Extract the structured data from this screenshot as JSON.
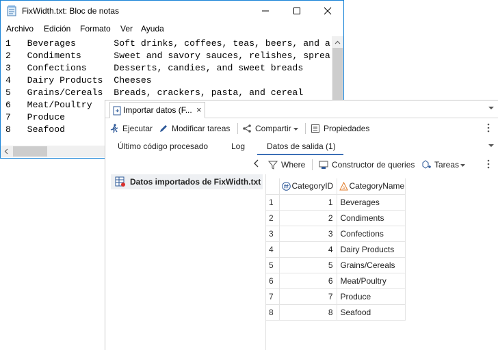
{
  "notepad": {
    "title": "FixWidth.txt: Bloc de notas",
    "menu": [
      "Archivo",
      "Edición",
      "Formato",
      "Ver",
      "Ayuda"
    ],
    "lines": [
      "1   Beverages       Soft drinks, coffees, teas, beers, and a",
      "2   Condiments      Sweet and savory sauces, relishes, sprea",
      "3   Confections     Desserts, candies, and sweet breads",
      "4   Dairy Products  Cheeses",
      "5   Grains/Cereals  Breads, crackers, pasta, and cereal",
      "6   Meat/Poultry",
      "7   Produce",
      "8   Seafood"
    ]
  },
  "sas": {
    "doc_tab": {
      "label": "Importar datos (F...",
      "close": "×"
    },
    "toolbar": {
      "run": "Ejecutar",
      "modify": "Modificar tareas",
      "share": "Compartir",
      "properties": "Propiedades"
    },
    "subtabs": [
      "Último código procesado",
      "Log",
      "Datos de salida (1)"
    ],
    "output_toolbar": {
      "where": "Where",
      "query_builder": "Constructor de queries",
      "tasks": "Tareas"
    },
    "tree_item": "Datos importados de FixWidth.txt",
    "grid": {
      "columns": [
        "CategoryID",
        "CategoryName"
      ],
      "rows": [
        {
          "n": "1",
          "id": "1",
          "name": "Beverages"
        },
        {
          "n": "2",
          "id": "2",
          "name": "Condiments"
        },
        {
          "n": "3",
          "id": "3",
          "name": "Confections"
        },
        {
          "n": "4",
          "id": "4",
          "name": "Dairy Products"
        },
        {
          "n": "5",
          "id": "5",
          "name": "Grains/Cereals"
        },
        {
          "n": "6",
          "id": "6",
          "name": "Meat/Poultry"
        },
        {
          "n": "7",
          "id": "7",
          "name": "Produce"
        },
        {
          "n": "8",
          "id": "8",
          "name": "Seafood"
        }
      ]
    }
  },
  "colors": {
    "window_border": "#1883d7",
    "accent": "#3b6fb6",
    "icon_blue": "#2b5797",
    "char_icon_orange": "#e07b28"
  }
}
